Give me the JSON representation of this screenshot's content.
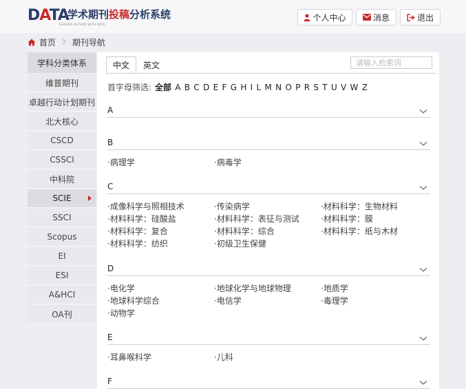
{
  "header": {
    "logo_text_main": "DATA",
    "logo_sub": "SERVING AUTHOR WITH DATA",
    "title_part1": "学术期刊",
    "title_highlight": "投稿",
    "title_part2": "分析系统",
    "buttons": {
      "profile": {
        "label": "个人中心",
        "icon": "user-icon"
      },
      "messages": {
        "label": "消息",
        "icon": "envelope-icon"
      },
      "logout": {
        "label": "退出",
        "icon": "sign-out-icon"
      }
    },
    "accent_color": "#c92a2a",
    "brand_color": "#2c3d6b"
  },
  "breadcrumb": {
    "home": "首页",
    "current": "期刊导航"
  },
  "sidebar": {
    "title": "学科分类体系",
    "items": [
      {
        "label": "维普期刊"
      },
      {
        "label": "卓越行动计划期刊"
      },
      {
        "label": "北大核心"
      },
      {
        "label": "CSCD"
      },
      {
        "label": "CSSCI"
      },
      {
        "label": "中科院"
      },
      {
        "label": "SCIE",
        "active": true
      },
      {
        "label": "SSCI"
      },
      {
        "label": "Scopus"
      },
      {
        "label": "EI"
      },
      {
        "label": "ESI"
      },
      {
        "label": "A&HCI"
      },
      {
        "label": "OA刊"
      }
    ]
  },
  "tabs": [
    {
      "label": "中文",
      "active": true
    },
    {
      "label": "英文",
      "active": false
    }
  ],
  "search": {
    "placeholder": "请输入检索词"
  },
  "letter_filter": {
    "label": "首字母筛选:",
    "all_label": "全部",
    "letters": [
      "A",
      "B",
      "C",
      "D",
      "E",
      "F",
      "G",
      "H",
      "I",
      "L",
      "M",
      "N",
      "O",
      "P",
      "R",
      "S",
      "T",
      "U",
      "V",
      "W",
      "Z"
    ]
  },
  "sections": [
    {
      "letter": "A",
      "entries": []
    },
    {
      "letter": "B",
      "entries": [
        "病理学",
        "病毒学"
      ]
    },
    {
      "letter": "C",
      "entries": [
        "成像科学与照相技术",
        "传染病学",
        "材料科学：生物材料",
        "材料科学：硅酸盐",
        "材料科学：表征与测试",
        "材料科学：膜",
        "材料科学：复合",
        "材料科学：综合",
        "材料科学：纸与木材",
        "材料科学：纺织",
        "初级卫生保健"
      ]
    },
    {
      "letter": "D",
      "entries": [
        "电化学",
        "地球化学与地球物理",
        "地质学",
        "地球科学综合",
        "电信学",
        "毒理学",
        "动物学"
      ]
    },
    {
      "letter": "E",
      "entries": [
        "耳鼻喉科学",
        "儿科"
      ]
    },
    {
      "letter": "F",
      "entries": []
    }
  ]
}
